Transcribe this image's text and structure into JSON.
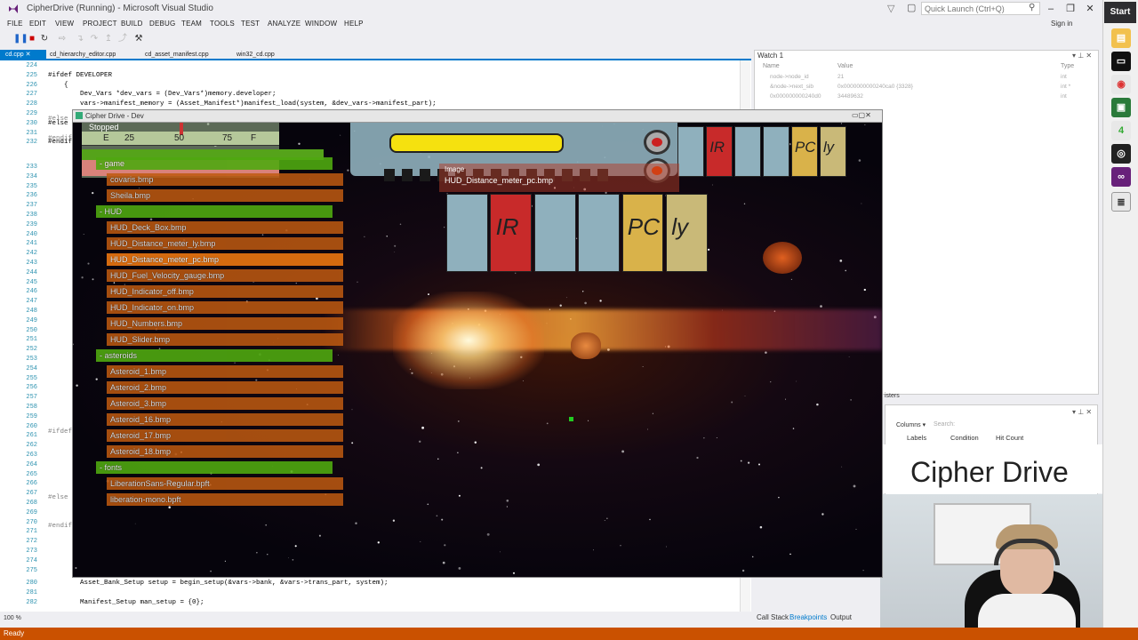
{
  "window": {
    "title": "CipherDrive (Running) - Microsoft Visual Studio",
    "quick_launch": "Quick Launch (Ctrl+Q)",
    "signin": "Sign in"
  },
  "menu": [
    "FILE",
    "EDIT",
    "VIEW",
    "PROJECT",
    "BUILD",
    "DEBUG",
    "TEAM",
    "TOOLS",
    "TEST",
    "ANALYZE",
    "WINDOW",
    "HELP"
  ],
  "tabs": [
    "cd.cpp",
    "cd_hierarchy_editor.cpp",
    "cd_asset_manifest.cpp",
    "win32_cd.cpp"
  ],
  "editor": {
    "lines": [
      {
        "n": "224",
        "t": ""
      },
      {
        "n": "225",
        "t": "#ifdef DEVELOPER"
      },
      {
        "n": "226",
        "t": "    {"
      },
      {
        "n": "227",
        "t": "        Dev_Vars *dev_vars = (Dev_Vars*)memory.developer;"
      },
      {
        "n": "228",
        "t": "        vars->manifest_memory = (Asset_Manifest*)manifest_load(system, &dev_vars->manifest_part);"
      },
      {
        "n": "229",
        "t": ""
      },
      {
        "n": "230",
        "t": "#else"
      },
      {
        "n": "231",
        "t": ""
      },
      {
        "n": "232",
        "t": "#endif"
      }
    ],
    "bottom_lines": [
      {
        "n": "280",
        "t": "        Asset_Bank_Setup setup = begin_setup(&vars->bank, &vars->trans_part, system);"
      },
      {
        "n": "281",
        "t": ""
      },
      {
        "n": "282",
        "t": "        Manifest_Setup man_setup = {0};"
      }
    ],
    "gutter_mid": [
      "233",
      "234",
      "235",
      "236",
      "237",
      "238",
      "239",
      "240",
      "241",
      "242",
      "243",
      "244",
      "245",
      "246",
      "247",
      "248",
      "249",
      "250",
      "251",
      "252",
      "253",
      "254",
      "255",
      "256",
      "257",
      "258",
      "259",
      "260",
      "261",
      "262",
      "263",
      "264",
      "265",
      "266",
      "267",
      "268",
      "269",
      "270",
      "271",
      "272",
      "273",
      "274",
      "275",
      "276",
      "277",
      "278",
      "279"
    ],
    "side_labels": [
      {
        "n": "230",
        "t": "#else"
      },
      {
        "n": "232",
        "t": "#endif"
      },
      {
        "n": "262",
        "t": "#ifdef"
      },
      {
        "n": "270",
        "t": "#else"
      },
      {
        "n": "272",
        "t": "#endif"
      }
    ],
    "zoom": "100 %"
  },
  "watch": {
    "title": "Watch 1",
    "cols": [
      "Name",
      "Value",
      "Type"
    ],
    "rows": [
      {
        "name": "node->node_id",
        "value": "21",
        "type": "int"
      },
      {
        "name": "&node->next_sib",
        "value": "0x0000000000240ca0 {3328}",
        "type": "int *"
      },
      {
        "name": "0x000000000240d0",
        "value": "34489632",
        "type": "int"
      }
    ]
  },
  "breakpoints": {
    "title_fragment": "isters",
    "columns_label": "Columns",
    "search_placeholder": "Search:",
    "cols": [
      "Labels",
      "Condition",
      "Hit Count"
    ]
  },
  "bottom_tabs": [
    "Call Stack",
    "Breakpoints",
    "Output"
  ],
  "status": "Ready",
  "game": {
    "title": "Cipher Drive - Dev",
    "stopped": "Stopped",
    "gauge_ticks": [
      "E",
      "25",
      "50",
      "75",
      "F"
    ],
    "image_label": "Image",
    "image_file": "HUD_Distance_meter_pc.bmp",
    "tree": [
      {
        "label": "- game",
        "kind": "dir",
        "indent": 0
      },
      {
        "label": "covaris.bmp",
        "kind": "file",
        "indent": 1
      },
      {
        "label": "Sheila.bmp",
        "kind": "file",
        "indent": 1
      },
      {
        "label": "- HUD",
        "kind": "dir",
        "indent": 0
      },
      {
        "label": "HUD_Deck_Box.bmp",
        "kind": "file",
        "indent": 1
      },
      {
        "label": "HUD_Distance_meter_ly.bmp",
        "kind": "file",
        "indent": 1
      },
      {
        "label": "HUD_Distance_meter_pc.bmp",
        "kind": "sel",
        "indent": 1
      },
      {
        "label": "HUD_Fuel_Velocity_gauge.bmp",
        "kind": "file",
        "indent": 1
      },
      {
        "label": "HUD_Indicator_off.bmp",
        "kind": "file",
        "indent": 1
      },
      {
        "label": "HUD_Indicator_on.bmp",
        "kind": "file",
        "indent": 1
      },
      {
        "label": "HUD_Numbers.bmp",
        "kind": "file",
        "indent": 1
      },
      {
        "label": "HUD_Slider.bmp",
        "kind": "file",
        "indent": 1
      },
      {
        "label": "- asteroids",
        "kind": "dir",
        "indent": 0
      },
      {
        "label": "Asteroid_1.bmp",
        "kind": "file",
        "indent": 1
      },
      {
        "label": "Asteroid_2.bmp",
        "kind": "file",
        "indent": 1
      },
      {
        "label": "Asteroid_3.bmp",
        "kind": "file",
        "indent": 1
      },
      {
        "label": "Asteroid_16.bmp",
        "kind": "file",
        "indent": 1
      },
      {
        "label": "Asteroid_17.bmp",
        "kind": "file",
        "indent": 1
      },
      {
        "label": "Asteroid_18.bmp",
        "kind": "file",
        "indent": 1
      },
      {
        "label": "- fonts",
        "kind": "dir",
        "indent": 0
      },
      {
        "label": "LiberationSans-Regular.bpft",
        "kind": "file",
        "indent": 1
      },
      {
        "label": "liberation-mono.bpft",
        "kind": "file",
        "indent": 1
      }
    ],
    "units": [
      "IR",
      "PC",
      "ly"
    ]
  },
  "overlay": {
    "brand": "Cipher Drive"
  },
  "taskbar": {
    "start": "Start"
  }
}
